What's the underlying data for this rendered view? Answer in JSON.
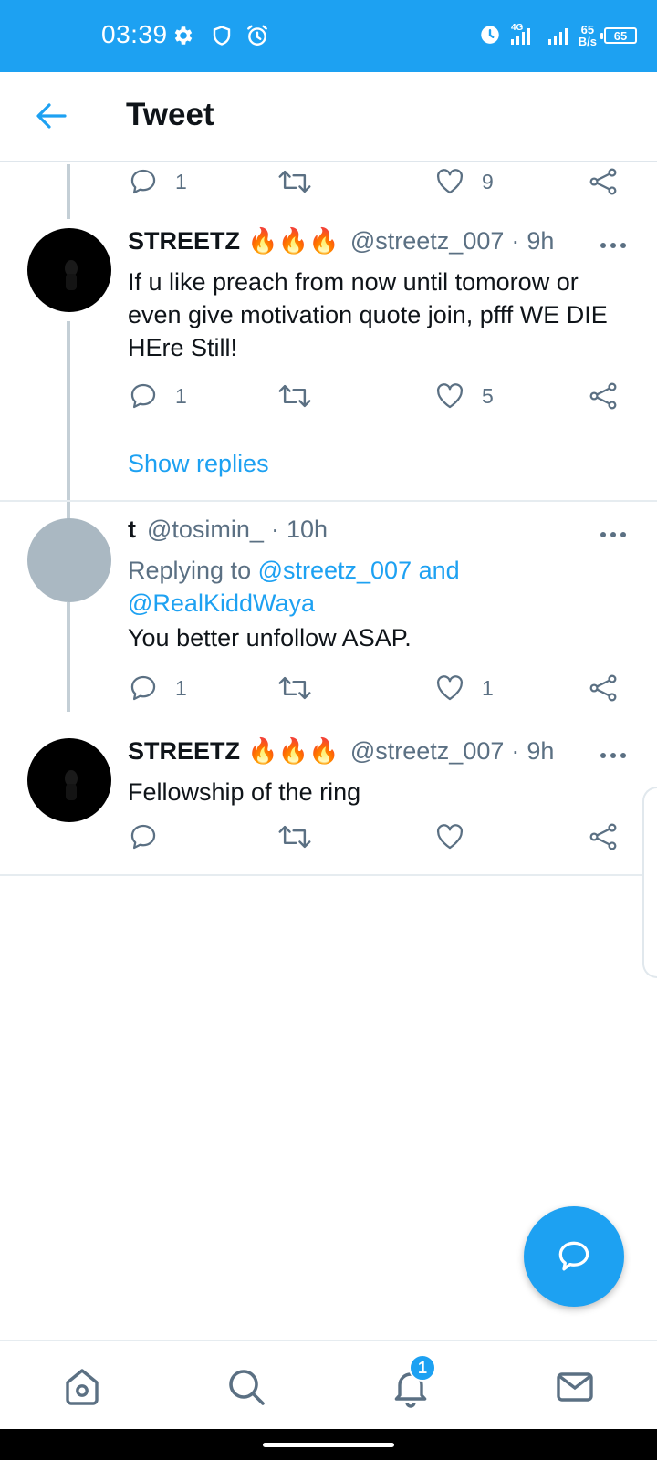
{
  "status_bar": {
    "time": "03:39",
    "net_speed_value": "65",
    "net_speed_unit": "B/s",
    "battery": "65",
    "network": "4G"
  },
  "header": {
    "title": "Tweet"
  },
  "tweets": [
    {
      "counts": {
        "reply": "1",
        "retweet": "",
        "like": "9"
      }
    },
    {
      "name": "STREETZ",
      "emoji": "🔥🔥🔥",
      "handle": "@streetz_007",
      "time": "9h",
      "text": "If u like preach from now until tomorow or even give motivation quote join, pfff WE DIE HEre Still!",
      "counts": {
        "reply": "1",
        "retweet": "",
        "like": "5"
      }
    },
    {
      "name": "t",
      "handle": "@tosimin_",
      "time": "10h",
      "replying_prefix": "Replying to ",
      "replying_user1": "@streetz_007",
      "replying_and": " and",
      "replying_user2": "@RealKiddWaya",
      "text": "You better unfollow ASAP.",
      "counts": {
        "reply": "1",
        "retweet": "",
        "like": "1"
      }
    },
    {
      "name": "STREETZ",
      "emoji": "🔥🔥🔥",
      "handle": "@streetz_007",
      "time": "9h",
      "text": "Fellowship of the ring",
      "counts": {
        "reply": "",
        "retweet": "",
        "like": ""
      }
    }
  ],
  "show_replies": "Show replies",
  "nav": {
    "notifications_badge": "1"
  },
  "colors": {
    "accent": "#1da1f2",
    "secondary_text": "#5b7083",
    "thread_line": "#c4cfd6"
  }
}
